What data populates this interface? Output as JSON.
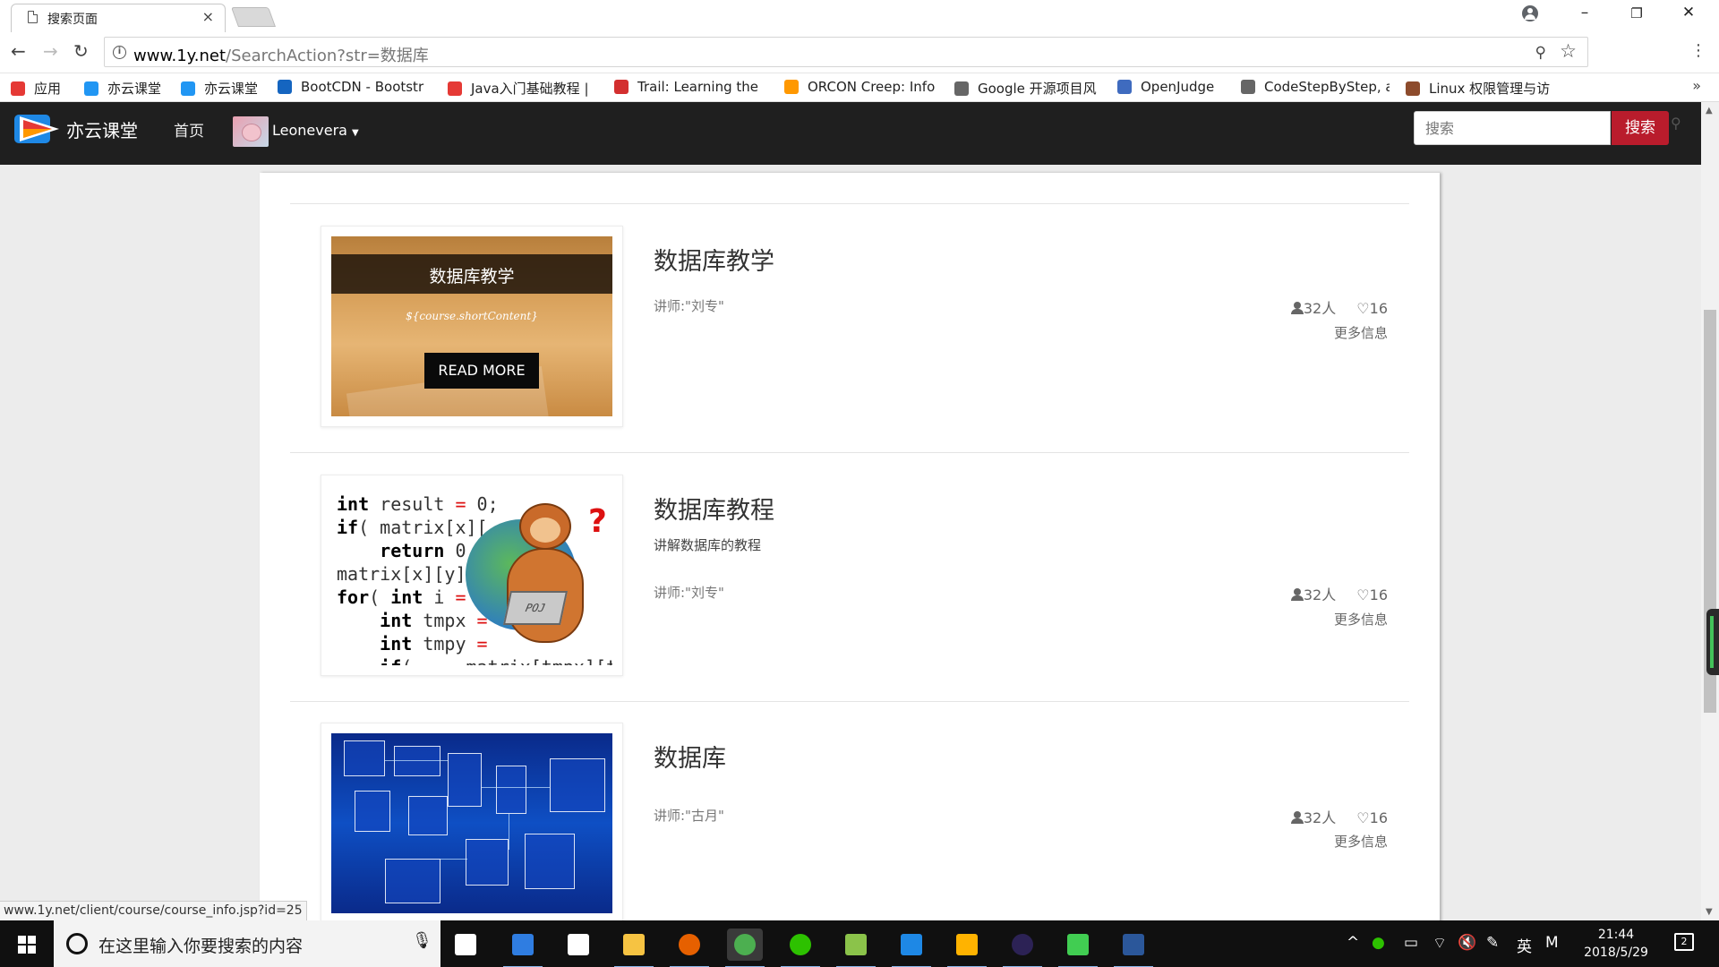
{
  "browser": {
    "tab_title": "搜索页面",
    "tab_close": "×",
    "url_host": "www.1y.net",
    "url_path": "/SearchAction?str=数据库",
    "window_controls": [
      "–",
      "❐",
      "✕"
    ],
    "bookmarks": [
      {
        "label": "应用",
        "icon": "apps-grid-icon",
        "color": "#e53935"
      },
      {
        "label": "亦云课堂",
        "icon": "yiyun-logo-icon",
        "color": "#2196f3"
      },
      {
        "label": "亦云课堂",
        "icon": "yiyun-logo-icon",
        "color": "#2196f3"
      },
      {
        "label": "BootCDN - Bootstr",
        "icon": "bootcdn-icon",
        "color": "#1565c0"
      },
      {
        "label": "Java入门基础教程 |",
        "icon": "java-icon",
        "color": "#e53935"
      },
      {
        "label": "Trail: Learning the",
        "icon": "oracle-icon",
        "color": "#d32f2f"
      },
      {
        "label": "ORCON Creep: Info",
        "icon": "orcon-icon",
        "color": "#ff9800"
      },
      {
        "label": "Google 开源项目风",
        "icon": "page-icon",
        "color": "#666666"
      },
      {
        "label": "OpenJudge",
        "icon": "poj-icon",
        "color": "#3f6bbf"
      },
      {
        "label": "CodeStepByStep, a",
        "icon": "page-icon",
        "color": "#666666"
      },
      {
        "label": "Linux 权限管理与访",
        "icon": "linux-icon",
        "color": "#8d4b2c"
      }
    ],
    "bookmarks_more": "»"
  },
  "site": {
    "logo_text": "亦云课堂",
    "nav_home": "首页",
    "user_name": "Leonevera",
    "search_placeholder": "搜索",
    "search_button": "搜索"
  },
  "courses": [
    {
      "title": "数据库教学",
      "description": "",
      "teacher": "讲师:\"刘专\"",
      "students": "32人",
      "likes": "16",
      "more": "更多信息",
      "thumb": {
        "kind": "banner",
        "title": "数据库教学",
        "subtitle": "${course.shortContent}",
        "button": "READ MORE"
      }
    },
    {
      "title": "数据库教程",
      "description": "讲解数据库的教程",
      "teacher": "讲师:\"刘专\"",
      "students": "32人",
      "likes": "16",
      "more": "更多信息",
      "thumb": {
        "kind": "poj-code",
        "laptop_label": "POJ"
      }
    },
    {
      "title": "数据库",
      "description": "",
      "teacher": "讲师:\"古月\"",
      "students": "32人",
      "likes": "16",
      "more": "更多信息",
      "thumb": {
        "kind": "er-diagram"
      }
    }
  ],
  "status_url": "www.1y.net/client/course/course_info.jsp?id=25",
  "taskbar": {
    "search_placeholder": "在这里输入你要搜索的内容",
    "apps": [
      {
        "name": "task-view-icon",
        "color": "#ffffff"
      },
      {
        "name": "edge-icon",
        "color": "#2f7de1"
      },
      {
        "name": "sticky-notes-icon",
        "color": "#ffffff"
      },
      {
        "name": "file-explorer-icon",
        "color": "#f6c342"
      },
      {
        "name": "firefox-icon",
        "color": "#e66000"
      },
      {
        "name": "chrome-icon",
        "color": "#4caf50"
      },
      {
        "name": "wechat-icon",
        "color": "#2dc100"
      },
      {
        "name": "image-viewer-icon",
        "color": "#8bc34a"
      },
      {
        "name": "devcpp-icon",
        "color": "#1e88e5"
      },
      {
        "name": "sandbox-icon",
        "color": "#ffb300"
      },
      {
        "name": "eclipse-icon",
        "color": "#2c2255"
      },
      {
        "name": "qt-icon",
        "color": "#41cd52"
      },
      {
        "name": "word-icon",
        "color": "#2b579a"
      }
    ],
    "ime": "英",
    "ime_mode": "M",
    "time": "21:44",
    "date": "2018/5/29",
    "notifications": "2"
  },
  "colors": {
    "navbar": "#1f1f1f",
    "search_button": "#b91c2c",
    "page_bg": "#ececec"
  }
}
